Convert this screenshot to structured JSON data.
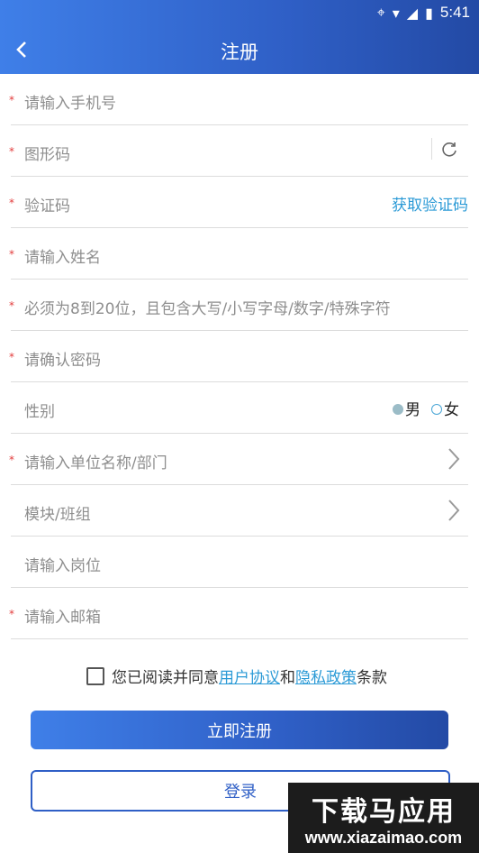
{
  "statusbar": {
    "time": "5:41"
  },
  "header": {
    "title": "注册"
  },
  "fields": [
    {
      "required": true,
      "placeholder": "请输入手机号"
    },
    {
      "required": true,
      "placeholder": "图形码"
    },
    {
      "required": true,
      "placeholder": "验证码",
      "action": "获取验证码"
    },
    {
      "required": true,
      "placeholder": "请输入姓名"
    },
    {
      "required": true,
      "placeholder": "必须为8到20位，且包含大写/小写字母/数字/特殊字符"
    },
    {
      "required": true,
      "placeholder": "请确认密码"
    },
    {
      "required": false,
      "label": "性别",
      "options": [
        "男",
        "女"
      ],
      "selected": "男"
    },
    {
      "required": true,
      "placeholder": "请输入单位名称/部门"
    },
    {
      "required": false,
      "placeholder": "模块/班组"
    },
    {
      "required": false,
      "placeholder": "请输入岗位"
    },
    {
      "required": true,
      "placeholder": "请输入邮箱"
    }
  ],
  "agreement": {
    "prefix": "您已阅读并同意",
    "user_agreement": "用户协议",
    "and": "和",
    "privacy_policy": "隐私政策",
    "suffix": "条款"
  },
  "buttons": {
    "register": "立即注册",
    "login": "登录"
  },
  "watermark": {
    "cn": "下载马应用",
    "en": "www.xiazaimao.com"
  },
  "required_mark": "*"
}
